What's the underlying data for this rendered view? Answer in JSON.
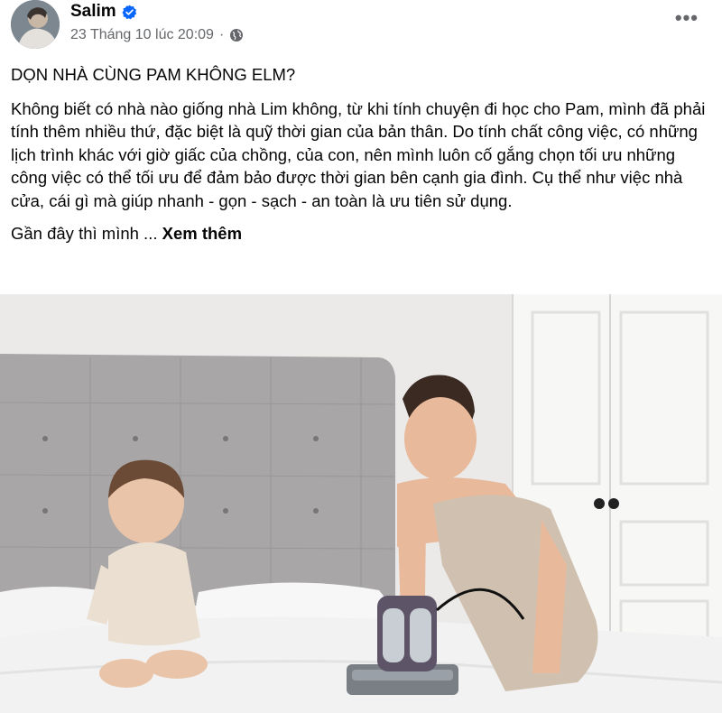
{
  "post": {
    "author": "Salim",
    "verified_icon": "verified-badge-icon",
    "timestamp": "23 Tháng 10 lúc 20:09",
    "separator": "·",
    "privacy_icon": "globe-icon",
    "more_icon": "more-options-icon",
    "title": "DỌN NHÀ CÙNG PAM KHÔNG ELM?",
    "body": "Không biết có nhà nào giống nhà Lim không, từ khi tính chuyện đi học cho Pam, mình đã phải tính thêm nhiều thứ, đặc biệt là quỹ thời gian của bản thân. Do tính chất công việc, có những lịch trình khác với giờ giấc của chồng, của con, nên mình luôn cố gắng chọn tối ưu những công việc có thể tối ưu để đảm bảo được thời gian bên cạnh gia đình. Cụ thể như việc nhà cửa, cái gì mà giúp nhanh - gọn - sạch - an toàn là ưu tiên sử dụng.",
    "teaser": "Gần đây thì mình ...",
    "see_more": "Xem thêm"
  },
  "colors": {
    "text": "#050505",
    "meta": "#65676b",
    "verified": "#0866ff"
  }
}
